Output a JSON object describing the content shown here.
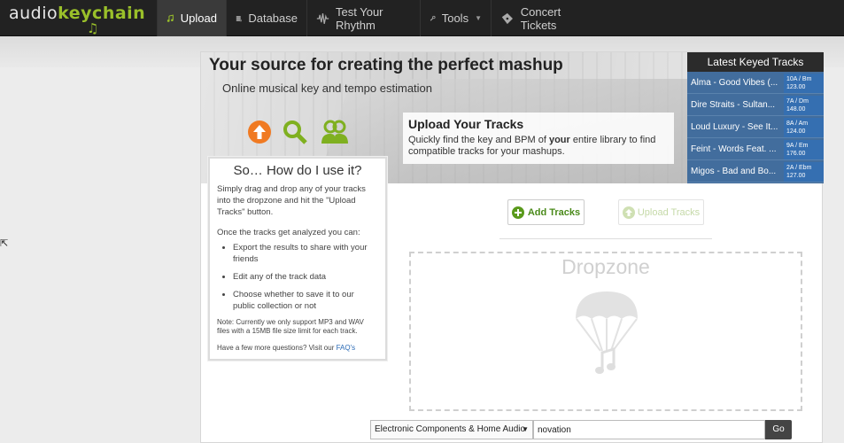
{
  "logo": {
    "audio": "audio",
    "keychain": "keychain"
  },
  "nav": {
    "upload": "Upload",
    "database": "Database",
    "rhythm": "Test Your Rhythm",
    "tools": "Tools",
    "tickets": "Concert Tickets"
  },
  "hero": {
    "title": "Your source for creating the perfect mashup",
    "subtitle": "Online musical key and tempo estimation",
    "upload_title": "Upload Your Tracks",
    "upload_text_a": "Quickly find the key and BPM of ",
    "upload_text_b": "your",
    "upload_text_c": " entire library to find compatible tracks for your mashups."
  },
  "latest": {
    "heading": "Latest Keyed Tracks",
    "tracks": [
      {
        "name": "Alma - Good Vibes (...",
        "key": "10A / Bm",
        "bpm": "123.00"
      },
      {
        "name": "Dire Straits - Sultan...",
        "key": "7A / Dm",
        "bpm": "148.00"
      },
      {
        "name": "Loud Luxury - See It...",
        "key": "8A / Am",
        "bpm": "124.00"
      },
      {
        "name": "Feint - Words Feat. ...",
        "key": "9A / Em",
        "bpm": "176.00"
      },
      {
        "name": "Migos - Bad and Bo...",
        "key": "2A / Ebm",
        "bpm": "127.00"
      }
    ]
  },
  "howto": {
    "title": "So… How do I use it?",
    "intro": "Simply drag and drop any of your tracks into the dropzone and hit the \"Upload Tracks\" button.",
    "once": "Once the tracks get analyzed you can:",
    "bullets": [
      "Export the results to share with your friends",
      "Edit any of the track data",
      "Choose whether to save it to our public collection or not"
    ],
    "note": "Note: Currently we only support MP3 and WAV files with a 15MB file size limit for each track.",
    "faq_prefix": "Have a few more questions? Visit our ",
    "faq_link": "FAQ's"
  },
  "actions": {
    "add": "Add Tracks",
    "upload": "Upload Tracks"
  },
  "dropzone": {
    "label": "Dropzone"
  },
  "search": {
    "category": "Electronic Components & Home Audio",
    "query": "novation",
    "go": "Go"
  },
  "colors": {
    "accent_green": "#9ac02a",
    "panel_blue": "#426d9d"
  }
}
